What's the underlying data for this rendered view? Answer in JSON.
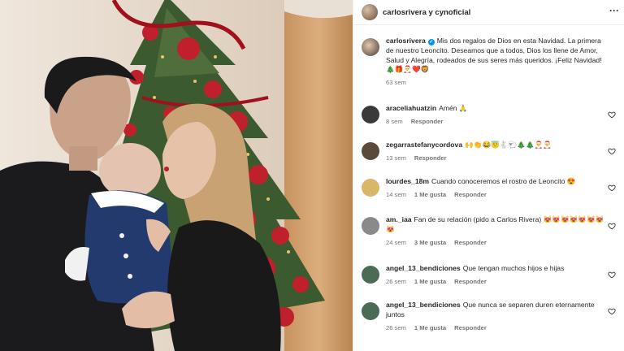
{
  "header": {
    "title": "carlosrivera y cynoficial"
  },
  "caption": {
    "user": "carlosrivera",
    "text": "Mis dos regalos de Dios en esta Navidad. La primera de nuestro Leoncito. Deseamos que a todos, Dios los llene de Amor, Salud y Alegría, rodeados de sus seres más queridos. ¡Feliz Navidad! 🎄🎁🎅❤️🦁",
    "time": "63 sem"
  },
  "comments": [
    {
      "user": "araceliahuatzin",
      "text": "Amén 🙏",
      "time": "8 sem",
      "likes": "",
      "reply": "Responder",
      "avatar_color": "#3a3a3a"
    },
    {
      "user": "zegarrastefanycordova",
      "text": "🙌👏😂😇🐇🐑🎄🎄🎅🎅",
      "time": "13 sem",
      "likes": "",
      "reply": "Responder",
      "avatar_color": "#5a4a3a"
    },
    {
      "user": "lourdes_18m",
      "text": "Cuando conoceremos el rostro de Leoncito 😍",
      "time": "14 sem",
      "likes": "1 Me gusta",
      "reply": "Responder",
      "avatar_color": "#d9b76a"
    },
    {
      "user": "am._iaa",
      "text": "Fan de su relación (pido a Carlos Rivera) 😻😻😻😻😻😻😻😻",
      "time": "24 sem",
      "likes": "3 Me gusta",
      "reply": "Responder",
      "avatar_color": "#8a8a8a"
    },
    {
      "user": "angel_13_bendiciones",
      "text": "Que tengan muchos hijos e hijas",
      "time": "26 sem",
      "likes": "1 Me gusta",
      "reply": "Responder",
      "avatar_color": "#4c6b55"
    },
    {
      "user": "angel_13_bendiciones",
      "text": "Que nunca se separen duren eternamente juntos",
      "time": "26 sem",
      "likes": "1 Me gusta",
      "reply": "Responder",
      "avatar_color": "#4c6b55"
    }
  ],
  "colors": {
    "verified": "#0095f6",
    "muted": "#737373",
    "text": "#262626"
  },
  "icons": {
    "more": "more-dots-icon",
    "like": "heart-icon",
    "verified": "verified-badge-icon"
  }
}
